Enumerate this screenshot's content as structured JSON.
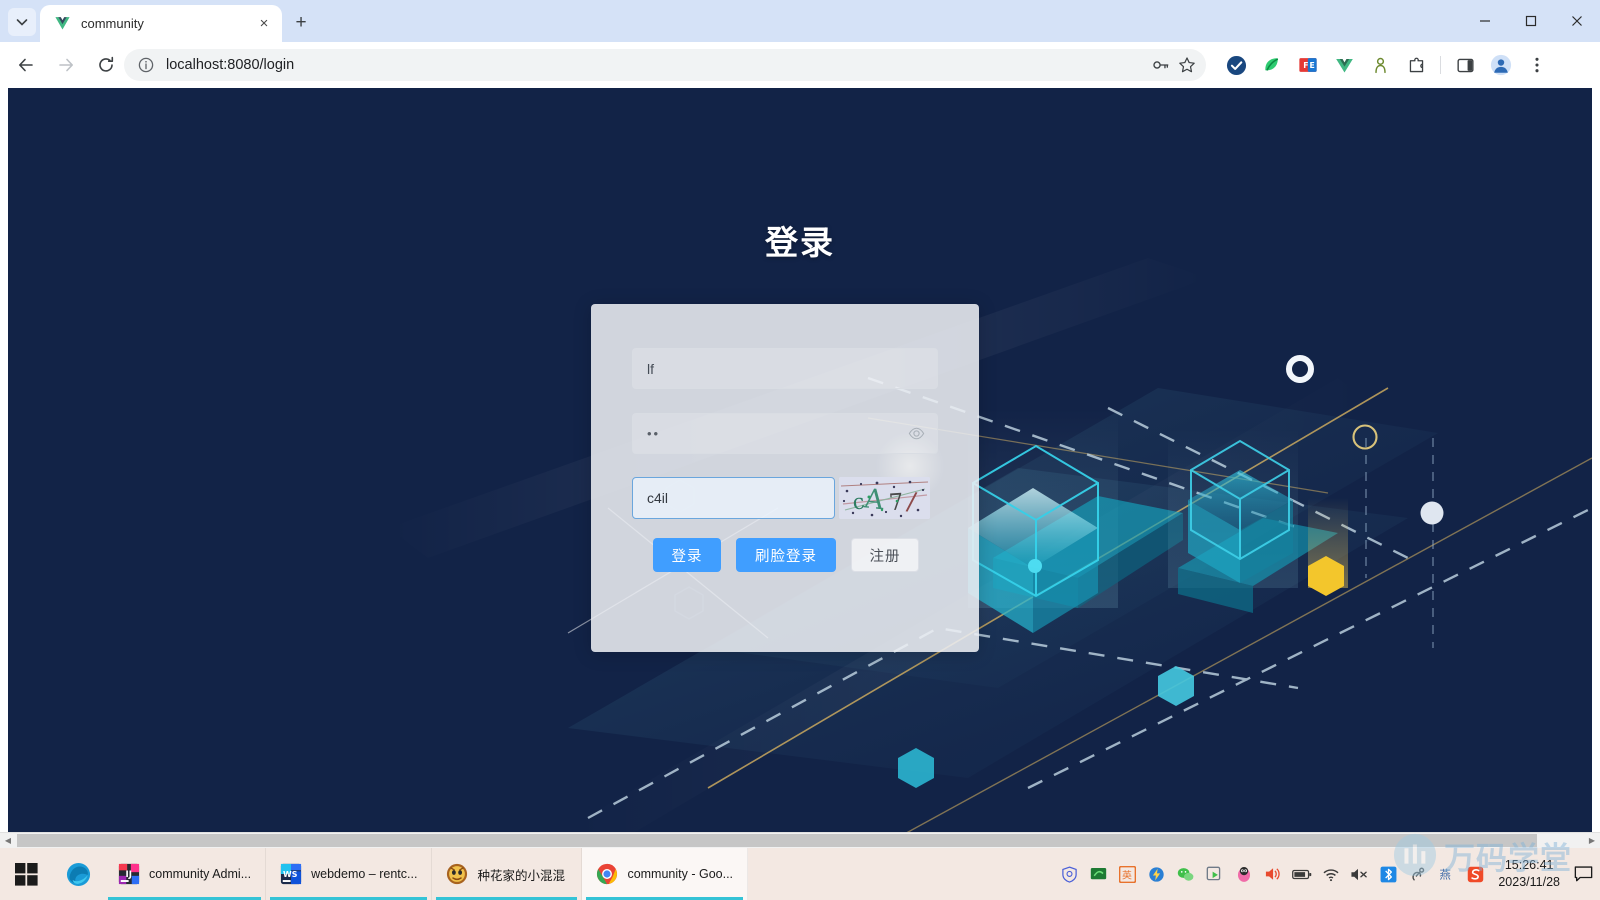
{
  "browser": {
    "tab": {
      "title": "community",
      "favicon": "vue-logo-icon",
      "close_label": "×"
    },
    "new_tab_label": "+",
    "window_controls": {
      "minimize": "–",
      "maximize": "❑",
      "close": "×"
    },
    "toolbar": {
      "back": "back-arrow-icon",
      "forward": "forward-arrow-icon",
      "reload": "reload-icon",
      "site_info": "info-circle-icon",
      "url": "localhost:8080/login",
      "password_manager": "key-icon",
      "bookmark": "star-icon",
      "extensions": [
        {
          "name": "ublock-shield-icon",
          "color": "#1b3a6b"
        },
        {
          "name": "green-swirl-icon",
          "color": "#27ae60"
        },
        {
          "name": "fe-helper-icon",
          "color": "#e53935"
        },
        {
          "name": "vue-devtools-icon",
          "color": "#41b883"
        },
        {
          "name": "keeper-person-icon",
          "color": "#6d8a2f"
        },
        {
          "name": "puzzle-piece-icon",
          "color": "#3c4043"
        }
      ],
      "side_panel": "side-panel-icon",
      "profile": "profile-avatar-icon",
      "chrome_menu": "three-dot-menu-icon"
    }
  },
  "page": {
    "title": "登录",
    "background_color": "#122347",
    "accent_color": "#409eff",
    "form": {
      "username": {
        "value": "lf",
        "name": "username-input"
      },
      "password": {
        "value": "••",
        "name": "password-input",
        "toggle_icon": "eye-icon"
      },
      "captcha": {
        "value": "c4il",
        "name": "captcha-input",
        "image_label": "captcha-image",
        "image_text": "cA7/"
      }
    },
    "buttons": {
      "login": "登录",
      "face_login": "刷脸登录",
      "register": "注册"
    },
    "scrollbar": {
      "left_arrow": "◀",
      "right_arrow": "▶"
    }
  },
  "taskbar": {
    "start": "windows-start-icon",
    "quick_launch": [
      {
        "name": "edge-icon"
      }
    ],
    "items": [
      {
        "label": "community Admi...",
        "icon": "intellij-idea-icon",
        "active": false
      },
      {
        "label": "webdemo – rentc...",
        "icon": "webstorm-icon",
        "active": false
      },
      {
        "label": "种花家的小混混",
        "icon": "game-app-icon",
        "active": false
      },
      {
        "label": "community - Goo...",
        "icon": "chrome-icon",
        "active": true
      }
    ],
    "tray": [
      {
        "name": "security-shield-icon"
      },
      {
        "name": "green-monitor-icon"
      },
      {
        "name": "ime-english-icon"
      },
      {
        "name": "thunder-download-icon"
      },
      {
        "name": "wechat-icon"
      },
      {
        "name": "screenshot-icon"
      },
      {
        "name": "qq-penguin-icon"
      },
      {
        "name": "volume-icon"
      },
      {
        "name": "battery-icon"
      },
      {
        "name": "wifi-icon"
      },
      {
        "name": "speaker-muted-icon"
      },
      {
        "name": "bluetooth-icon"
      },
      {
        "name": "usb-device-icon"
      },
      {
        "name": "ime-pen-icon"
      },
      {
        "name": "sogou-input-icon"
      }
    ],
    "clock": {
      "time": "15:26:41",
      "date": "2023/11/28"
    },
    "notifications": "notification-icon"
  },
  "watermark": {
    "text": "万码学堂",
    "color": "#7fb3d9"
  }
}
